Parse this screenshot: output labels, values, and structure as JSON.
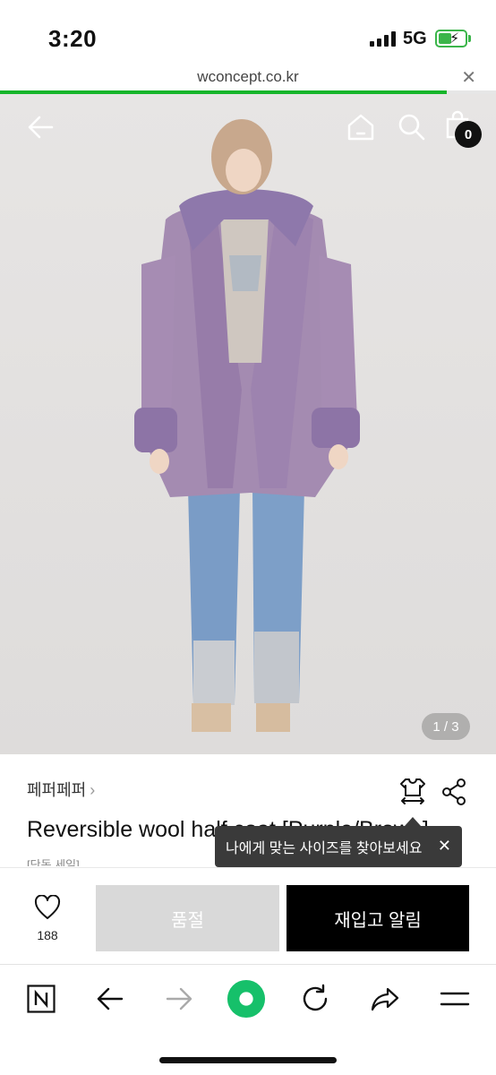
{
  "status_bar": {
    "time": "3:20",
    "network": "5G"
  },
  "browser": {
    "url": "wconcept.co.kr",
    "close_symbol": "✕",
    "load_progress": 0.9
  },
  "hero": {
    "cart_count": "0",
    "page_indicator": "1 / 3"
  },
  "product": {
    "brand": "페퍼페퍼",
    "brand_chevron": "›",
    "title": "Reversible wool half coat [Purple/Brown]",
    "subtitle": "[단독 세일]"
  },
  "tooltip": {
    "text": "나에게 맞는 사이즈를 찾아보세요",
    "close_symbol": "✕"
  },
  "action_bar": {
    "like_count": "188",
    "soldout_label": "품절",
    "restock_label": "재입고 알림"
  },
  "colors": {
    "accent_green": "#16b52a",
    "soldout_gray": "#d9d9d9",
    "primary_black": "#000000"
  },
  "icons": [
    "back-arrow-icon",
    "home-icon",
    "search-icon",
    "shopping-bag-icon",
    "size-guide-icon",
    "share-icon",
    "heart-icon",
    "naver-icon",
    "forward-arrow-icon",
    "green-dot-icon",
    "refresh-icon",
    "share-arrow-icon",
    "menu-icon"
  ]
}
